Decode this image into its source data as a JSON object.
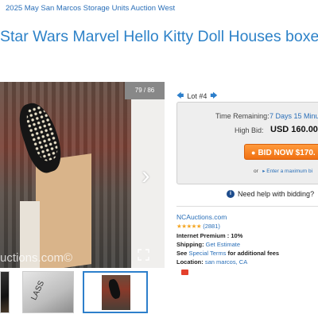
{
  "breadcrumb": "2025 May San Marcos Storage Units Auction West",
  "title": "Star Wars Marvel Hello Kitty Doll Houses boxes D",
  "gallery": {
    "counter": "79 / 86",
    "watermark": "uctions.com©",
    "thumb2_label": "LASS"
  },
  "lot": {
    "label": "Lot #4"
  },
  "bidding": {
    "time_remaining_label": "Time Remaining:",
    "time_remaining_value": "7 Days 15 Minu",
    "high_bid_label": "High Bid:",
    "high_bid_value": "USD 160.00",
    "bid_button_label": "BID NOW $170.",
    "or_text": "or",
    "max_bid_link": "▸ Enter a maximum bi"
  },
  "help": {
    "text": "Need help with bidding?"
  },
  "seller": {
    "name": "NCAuctions.com",
    "stars": "★★★★★",
    "rating_count": "(2881)",
    "premium_label": "Internet Premium : 10%",
    "shipping_label": "Shipping:",
    "shipping_link": "Get Estimate",
    "see_text": "See",
    "special_terms_link": "Special Terms",
    "additional_text": "for additional fees",
    "location_label": "Location:",
    "location_value": "san marcos, CA"
  },
  "colors": {
    "accent": "#2d82c8",
    "bid_button": "#f47b1a",
    "stars": "#f5a623"
  }
}
